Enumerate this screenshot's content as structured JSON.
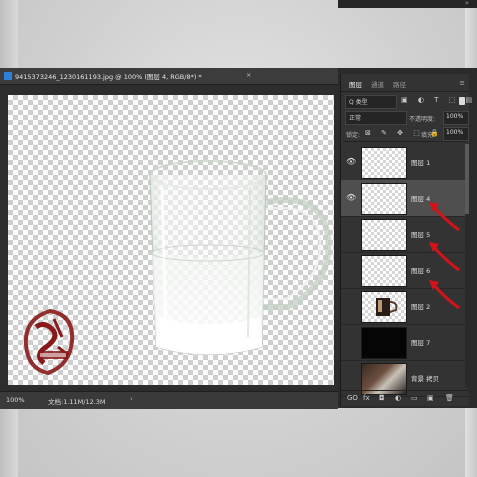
{
  "document": {
    "title": "9415373246_1230161193.jpg @ 100% (图层 4, RGB/8*) *",
    "close_glyph": "×"
  },
  "status_bar": {
    "zoom": "100%",
    "doc_info": "文档:1.11M/12.3M",
    "arrow": "›"
  },
  "panel": {
    "collapse_glyph": "»",
    "tabs": [
      {
        "label": "图层",
        "active": true
      },
      {
        "label": "通道",
        "active": false
      },
      {
        "label": "路径",
        "active": false
      }
    ],
    "menu_glyph": "≡",
    "filter_kind": "Q 类型",
    "filter_icons": "▣ ◐ T ⬚ ▤",
    "blend_mode": "正常",
    "opacity_label": "不透明度:",
    "opacity_value": "100%",
    "lock_label": "锁定:",
    "lock_icons": "⊠ ✎ ✥ ⬚ 🔒",
    "fill_label": "填充:",
    "fill_value": "100%",
    "bottom_icons": [
      "GO",
      "fx",
      "◘",
      "◐",
      "▭",
      "▣",
      "🗑"
    ],
    "layers": [
      {
        "name": "图层 1",
        "visible": true,
        "selected": false,
        "thumb": "transparent"
      },
      {
        "name": "图层 4",
        "visible": true,
        "selected": true,
        "thumb": "transparent"
      },
      {
        "name": "图层 5",
        "visible": false,
        "selected": false,
        "thumb": "transparent"
      },
      {
        "name": "图层 6",
        "visible": false,
        "selected": false,
        "thumb": "transparent"
      },
      {
        "name": "图层 2",
        "visible": false,
        "selected": false,
        "thumb": "photo"
      },
      {
        "name": "图层 7",
        "visible": false,
        "selected": false,
        "thumb": "black"
      },
      {
        "name": "背景 拷贝",
        "visible": false,
        "selected": false,
        "thumb": "photo"
      }
    ]
  },
  "colors": {
    "ps_badge": "#2e7fd6",
    "annotation_arrow": "#d0141a",
    "stamp": "#8a1a1a"
  },
  "icons": {
    "eye": "eye-icon",
    "visibility_glyph": "👁"
  }
}
